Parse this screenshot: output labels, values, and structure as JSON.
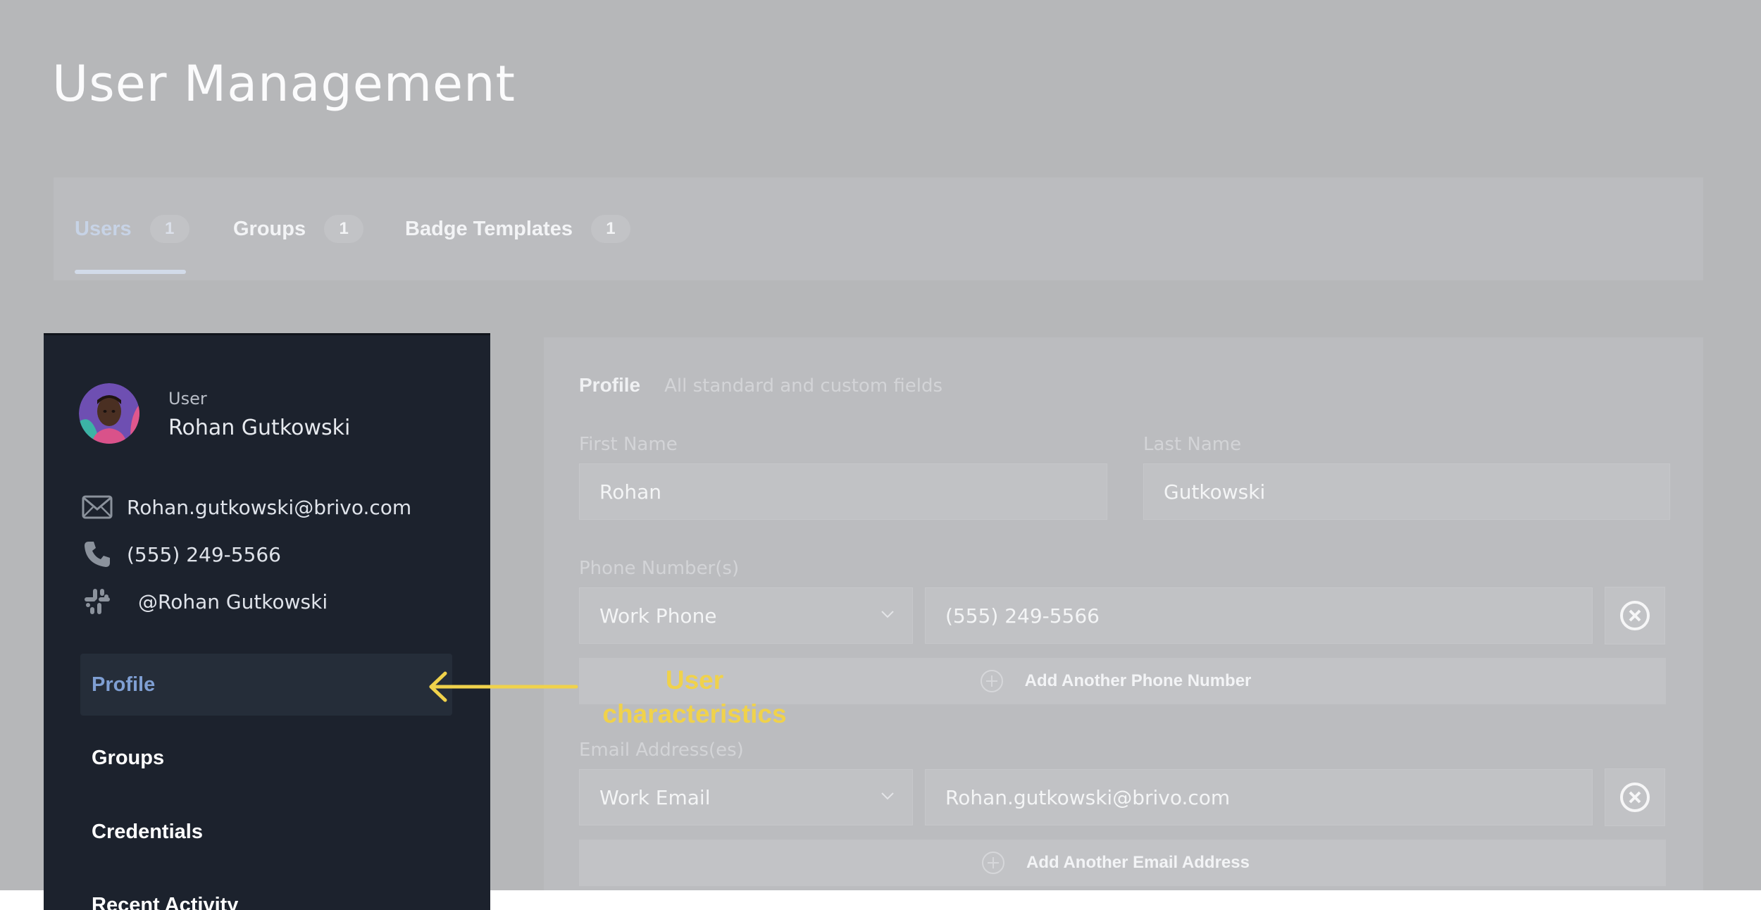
{
  "page": {
    "title": "User Management"
  },
  "tabs": [
    {
      "label": "Users",
      "count": "1",
      "active": true
    },
    {
      "label": "Groups",
      "count": "1"
    },
    {
      "label": "Badge Templates",
      "count": "1"
    }
  ],
  "sidebar": {
    "user_role": "User",
    "user_name": "Rohan Gutkowski",
    "email": "Rohan.gutkowski@brivo.com",
    "phone": "(555) 249-5566",
    "slack": "@Rohan Gutkowski",
    "nav": [
      {
        "label": "Profile",
        "active": true
      },
      {
        "label": "Groups"
      },
      {
        "label": "Credentials"
      },
      {
        "label": "Recent Activity"
      }
    ]
  },
  "profile": {
    "section_title": "Profile",
    "section_subtitle": "All standard and custom fields",
    "first_name_label": "First Name",
    "first_name_value": "Rohan",
    "last_name_label": "Last Name",
    "last_name_value": "Gutkowski",
    "phone_label": "Phone Number(s)",
    "phone_type": "Work Phone",
    "phone_value": "(555) 249-5566",
    "add_phone_label": "Add Another Phone Number",
    "email_label": "Email Address(es)",
    "email_type": "Work Email",
    "email_value": "Rohan.gutkowski@brivo.com",
    "add_email_label": "Add Another Email Address"
  },
  "annotation": {
    "line1": "User",
    "line2": "characteristics",
    "color": "#f0d24b"
  },
  "colors": {
    "overlay": "#b6b7b9",
    "sidebar_bg": "#1c222d",
    "accent": "#7f9fd3"
  }
}
